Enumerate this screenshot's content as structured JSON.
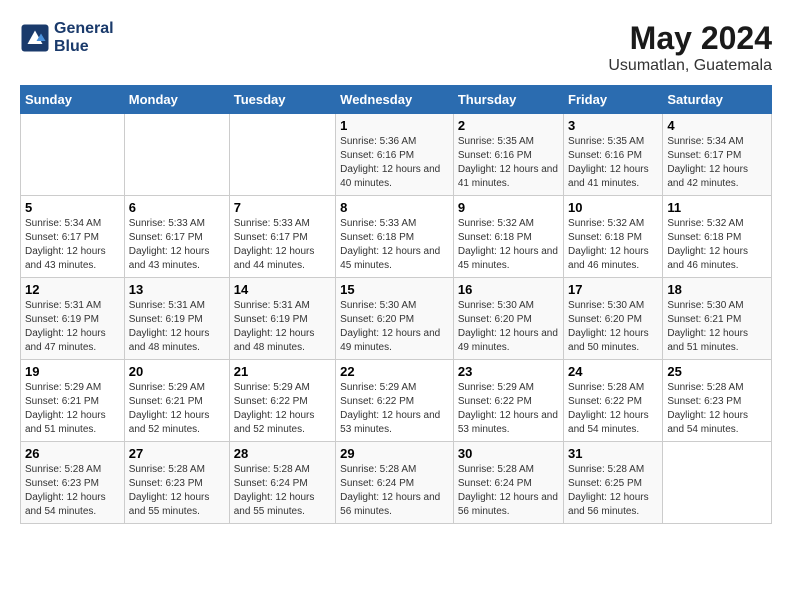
{
  "header": {
    "logo_line1": "General",
    "logo_line2": "Blue",
    "month_year": "May 2024",
    "location": "Usumatlan, Guatemala"
  },
  "days_of_week": [
    "Sunday",
    "Monday",
    "Tuesday",
    "Wednesday",
    "Thursday",
    "Friday",
    "Saturday"
  ],
  "weeks": [
    [
      {
        "num": "",
        "sunrise": "",
        "sunset": "",
        "daylight": ""
      },
      {
        "num": "",
        "sunrise": "",
        "sunset": "",
        "daylight": ""
      },
      {
        "num": "",
        "sunrise": "",
        "sunset": "",
        "daylight": ""
      },
      {
        "num": "1",
        "sunrise": "Sunrise: 5:36 AM",
        "sunset": "Sunset: 6:16 PM",
        "daylight": "Daylight: 12 hours and 40 minutes."
      },
      {
        "num": "2",
        "sunrise": "Sunrise: 5:35 AM",
        "sunset": "Sunset: 6:16 PM",
        "daylight": "Daylight: 12 hours and 41 minutes."
      },
      {
        "num": "3",
        "sunrise": "Sunrise: 5:35 AM",
        "sunset": "Sunset: 6:16 PM",
        "daylight": "Daylight: 12 hours and 41 minutes."
      },
      {
        "num": "4",
        "sunrise": "Sunrise: 5:34 AM",
        "sunset": "Sunset: 6:17 PM",
        "daylight": "Daylight: 12 hours and 42 minutes."
      }
    ],
    [
      {
        "num": "5",
        "sunrise": "Sunrise: 5:34 AM",
        "sunset": "Sunset: 6:17 PM",
        "daylight": "Daylight: 12 hours and 43 minutes."
      },
      {
        "num": "6",
        "sunrise": "Sunrise: 5:33 AM",
        "sunset": "Sunset: 6:17 PM",
        "daylight": "Daylight: 12 hours and 43 minutes."
      },
      {
        "num": "7",
        "sunrise": "Sunrise: 5:33 AM",
        "sunset": "Sunset: 6:17 PM",
        "daylight": "Daylight: 12 hours and 44 minutes."
      },
      {
        "num": "8",
        "sunrise": "Sunrise: 5:33 AM",
        "sunset": "Sunset: 6:18 PM",
        "daylight": "Daylight: 12 hours and 45 minutes."
      },
      {
        "num": "9",
        "sunrise": "Sunrise: 5:32 AM",
        "sunset": "Sunset: 6:18 PM",
        "daylight": "Daylight: 12 hours and 45 minutes."
      },
      {
        "num": "10",
        "sunrise": "Sunrise: 5:32 AM",
        "sunset": "Sunset: 6:18 PM",
        "daylight": "Daylight: 12 hours and 46 minutes."
      },
      {
        "num": "11",
        "sunrise": "Sunrise: 5:32 AM",
        "sunset": "Sunset: 6:18 PM",
        "daylight": "Daylight: 12 hours and 46 minutes."
      }
    ],
    [
      {
        "num": "12",
        "sunrise": "Sunrise: 5:31 AM",
        "sunset": "Sunset: 6:19 PM",
        "daylight": "Daylight: 12 hours and 47 minutes."
      },
      {
        "num": "13",
        "sunrise": "Sunrise: 5:31 AM",
        "sunset": "Sunset: 6:19 PM",
        "daylight": "Daylight: 12 hours and 48 minutes."
      },
      {
        "num": "14",
        "sunrise": "Sunrise: 5:31 AM",
        "sunset": "Sunset: 6:19 PM",
        "daylight": "Daylight: 12 hours and 48 minutes."
      },
      {
        "num": "15",
        "sunrise": "Sunrise: 5:30 AM",
        "sunset": "Sunset: 6:20 PM",
        "daylight": "Daylight: 12 hours and 49 minutes."
      },
      {
        "num": "16",
        "sunrise": "Sunrise: 5:30 AM",
        "sunset": "Sunset: 6:20 PM",
        "daylight": "Daylight: 12 hours and 49 minutes."
      },
      {
        "num": "17",
        "sunrise": "Sunrise: 5:30 AM",
        "sunset": "Sunset: 6:20 PM",
        "daylight": "Daylight: 12 hours and 50 minutes."
      },
      {
        "num": "18",
        "sunrise": "Sunrise: 5:30 AM",
        "sunset": "Sunset: 6:21 PM",
        "daylight": "Daylight: 12 hours and 51 minutes."
      }
    ],
    [
      {
        "num": "19",
        "sunrise": "Sunrise: 5:29 AM",
        "sunset": "Sunset: 6:21 PM",
        "daylight": "Daylight: 12 hours and 51 minutes."
      },
      {
        "num": "20",
        "sunrise": "Sunrise: 5:29 AM",
        "sunset": "Sunset: 6:21 PM",
        "daylight": "Daylight: 12 hours and 52 minutes."
      },
      {
        "num": "21",
        "sunrise": "Sunrise: 5:29 AM",
        "sunset": "Sunset: 6:22 PM",
        "daylight": "Daylight: 12 hours and 52 minutes."
      },
      {
        "num": "22",
        "sunrise": "Sunrise: 5:29 AM",
        "sunset": "Sunset: 6:22 PM",
        "daylight": "Daylight: 12 hours and 53 minutes."
      },
      {
        "num": "23",
        "sunrise": "Sunrise: 5:29 AM",
        "sunset": "Sunset: 6:22 PM",
        "daylight": "Daylight: 12 hours and 53 minutes."
      },
      {
        "num": "24",
        "sunrise": "Sunrise: 5:28 AM",
        "sunset": "Sunset: 6:22 PM",
        "daylight": "Daylight: 12 hours and 54 minutes."
      },
      {
        "num": "25",
        "sunrise": "Sunrise: 5:28 AM",
        "sunset": "Sunset: 6:23 PM",
        "daylight": "Daylight: 12 hours and 54 minutes."
      }
    ],
    [
      {
        "num": "26",
        "sunrise": "Sunrise: 5:28 AM",
        "sunset": "Sunset: 6:23 PM",
        "daylight": "Daylight: 12 hours and 54 minutes."
      },
      {
        "num": "27",
        "sunrise": "Sunrise: 5:28 AM",
        "sunset": "Sunset: 6:23 PM",
        "daylight": "Daylight: 12 hours and 55 minutes."
      },
      {
        "num": "28",
        "sunrise": "Sunrise: 5:28 AM",
        "sunset": "Sunset: 6:24 PM",
        "daylight": "Daylight: 12 hours and 55 minutes."
      },
      {
        "num": "29",
        "sunrise": "Sunrise: 5:28 AM",
        "sunset": "Sunset: 6:24 PM",
        "daylight": "Daylight: 12 hours and 56 minutes."
      },
      {
        "num": "30",
        "sunrise": "Sunrise: 5:28 AM",
        "sunset": "Sunset: 6:24 PM",
        "daylight": "Daylight: 12 hours and 56 minutes."
      },
      {
        "num": "31",
        "sunrise": "Sunrise: 5:28 AM",
        "sunset": "Sunset: 6:25 PM",
        "daylight": "Daylight: 12 hours and 56 minutes."
      },
      {
        "num": "",
        "sunrise": "",
        "sunset": "",
        "daylight": ""
      }
    ]
  ],
  "colors": {
    "header_bg": "#2e6db4",
    "brand_dark": "#1a3a6b"
  }
}
